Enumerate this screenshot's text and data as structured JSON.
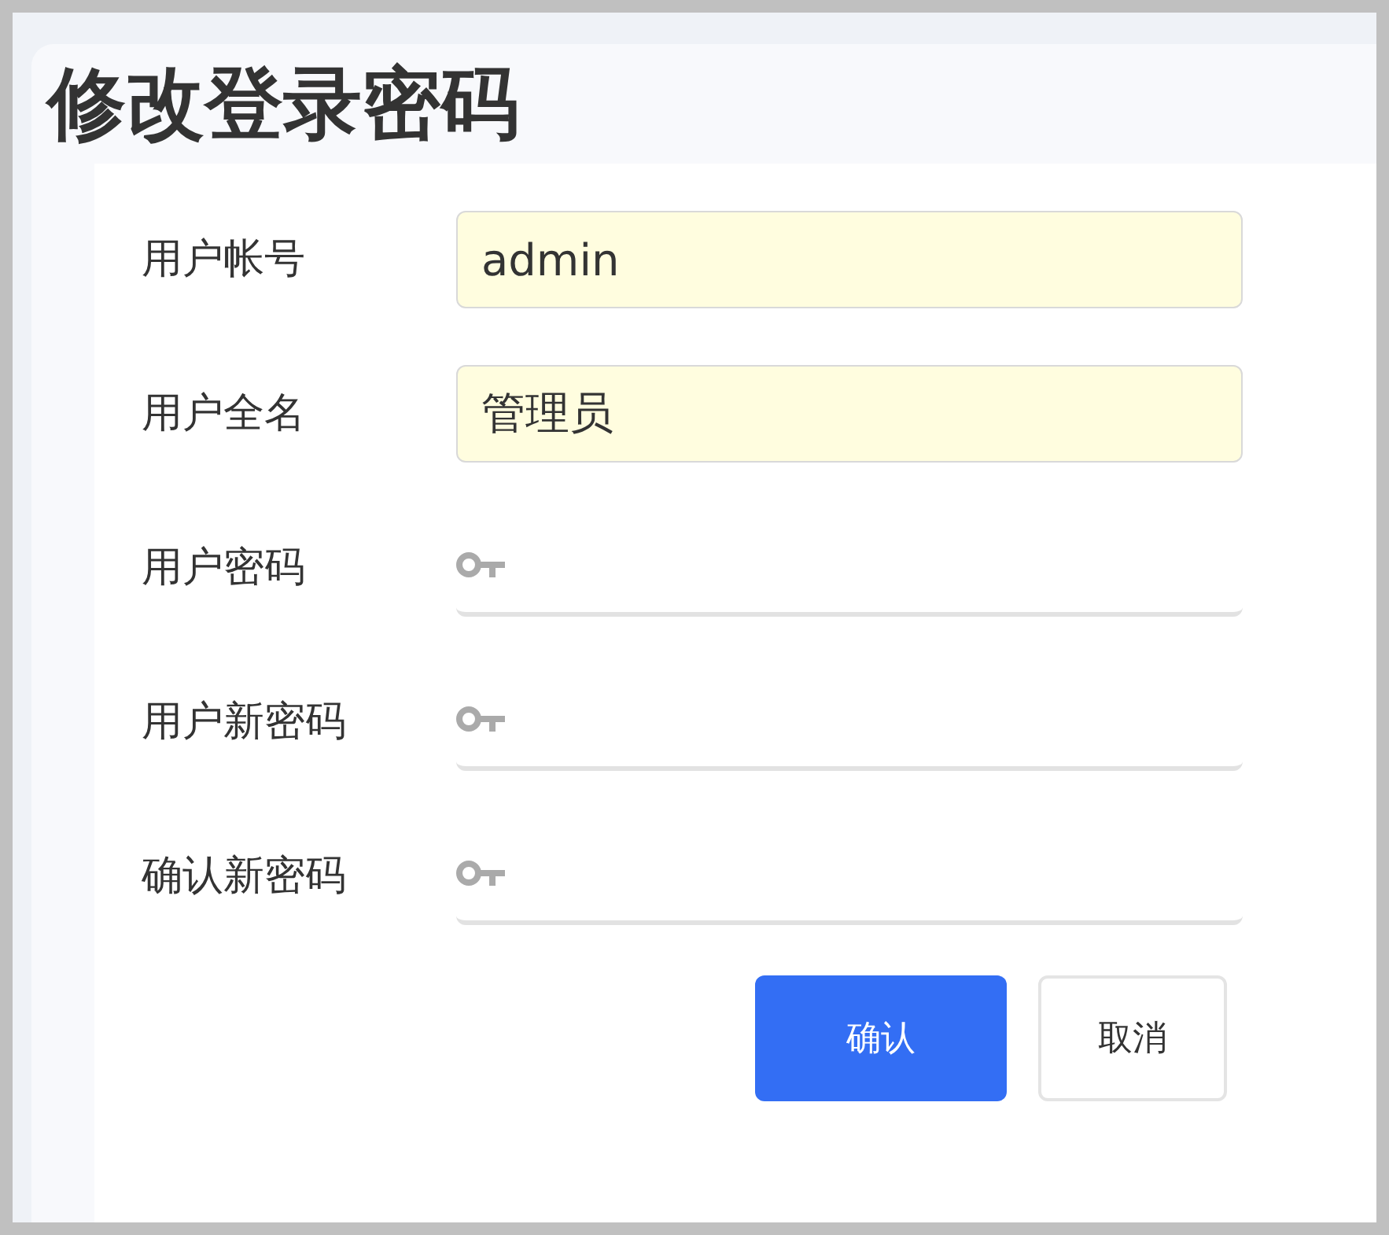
{
  "title": "修改登录密码",
  "fields": [
    {
      "label": "用户帐号",
      "kind": "text",
      "value": "admin"
    },
    {
      "label": "用户全名",
      "kind": "text",
      "value": "管理员"
    },
    {
      "label": "用户密码",
      "kind": "password"
    },
    {
      "label": "用户新密码",
      "kind": "password"
    },
    {
      "label": "确认新密码",
      "kind": "password"
    }
  ],
  "buttons": [
    {
      "label": "确认",
      "kind": "primary"
    },
    {
      "label": "取消",
      "kind": "secondary"
    }
  ]
}
